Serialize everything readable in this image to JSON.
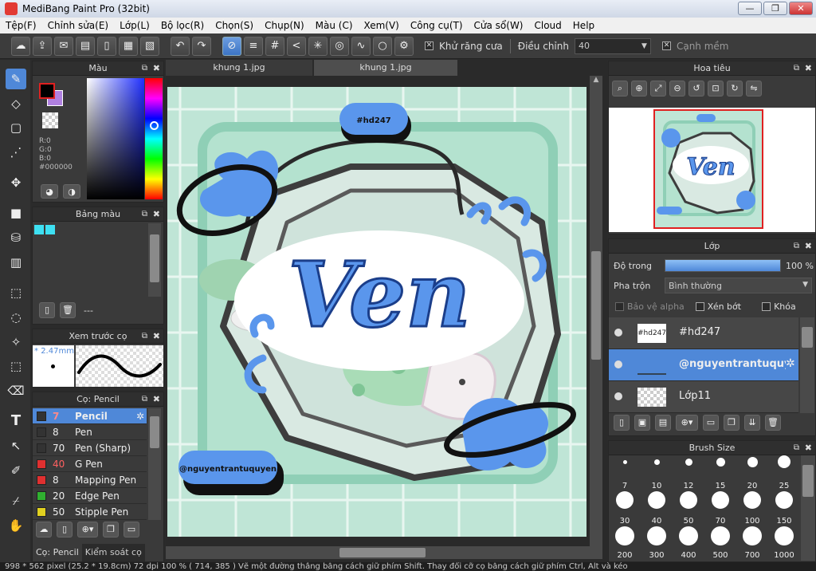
{
  "window": {
    "title": "MediBang Paint Pro (32bit)",
    "min": "—",
    "max": "❐",
    "close": "✕"
  },
  "menu": [
    "Tệp(F)",
    "Chỉnh sửa(E)",
    "Lớp(L)",
    "Bộ lọc(R)",
    "Chọn(S)",
    "Chụp(N)",
    "Màu (C)",
    "Xem(V)",
    "Công cụ(T)",
    "Cửa sổ(W)",
    "Cloud",
    "Help"
  ],
  "toolbar": {
    "antialias_label": "Khử răng cưa",
    "correction_label": "Điều chỉnh",
    "correction_value": "40",
    "smooth_label": "Cạnh mềm"
  },
  "color_panel": {
    "title": "Màu",
    "r": "R:0",
    "g": "G:0",
    "b": "B:0",
    "hex": "#000000"
  },
  "palette_panel": {
    "title": "Bảng màu",
    "footer_text": "---",
    "swatches": [
      "#3ee0f2",
      "#3ee0f2"
    ]
  },
  "preview_panel": {
    "title": "Xem trước cọ",
    "size": "2.47mm"
  },
  "brush_panel": {
    "title": "Cọ: Pencil",
    "brushes": [
      {
        "size": "7",
        "name": "Pencil",
        "color": "#333333"
      },
      {
        "size": "8",
        "name": "Pen",
        "color": "#333333"
      },
      {
        "size": "70",
        "name": "Pen (Sharp)",
        "color": "#333333"
      },
      {
        "size": "40",
        "name": "G Pen",
        "color": "#e03030"
      },
      {
        "size": "8",
        "name": "Mapping Pen",
        "color": "#e03030"
      },
      {
        "size": "20",
        "name": "Edge Pen",
        "color": "#30b030"
      },
      {
        "size": "50",
        "name": "Stipple Pen",
        "color": "#e0d020"
      }
    ],
    "tabs": [
      "Cọ: Pencil",
      "Kiểm soát cọ"
    ]
  },
  "canvas": {
    "tabs": [
      "khung 1.jpg",
      "khung 1.jpg"
    ],
    "sticker_top": "#hd247",
    "sticker_bottom": "@nguyentrantuquyen",
    "title_art": "Ven"
  },
  "navigator": {
    "title": "Hoa tiêu"
  },
  "layers": {
    "title": "Lớp",
    "opacity_label": "Độ trong",
    "opacity_value": "100 %",
    "opacity": 1.0,
    "blend_label": "Pha trộn",
    "blend_value": "Bình thường",
    "protect_alpha": "Bảo vệ alpha",
    "clip": "Xén bớt",
    "lock": "Khóa",
    "items": [
      {
        "name": "#hđ247",
        "thumb": "#hd247"
      },
      {
        "name": "@nguyentrantuquyen",
        "thumb": ""
      },
      {
        "name": "Lớp11",
        "thumb": ""
      }
    ]
  },
  "brush_size": {
    "title": "Brush Size",
    "sizes": [
      "7",
      "10",
      "12",
      "15",
      "20",
      "25",
      "30",
      "40",
      "50",
      "70",
      "100",
      "150",
      "200",
      "300",
      "400",
      "500",
      "700",
      "1000"
    ]
  },
  "status": "998 * 562 pixel (25.2 * 19.8cm) 72 dpi 100 % ( 714, 385 ) Vẽ một đường thẳng bằng cách giữ phím Shift. Thay đổi cỡ cọ bằng cách giữ phím Ctrl, Alt và kéo"
}
